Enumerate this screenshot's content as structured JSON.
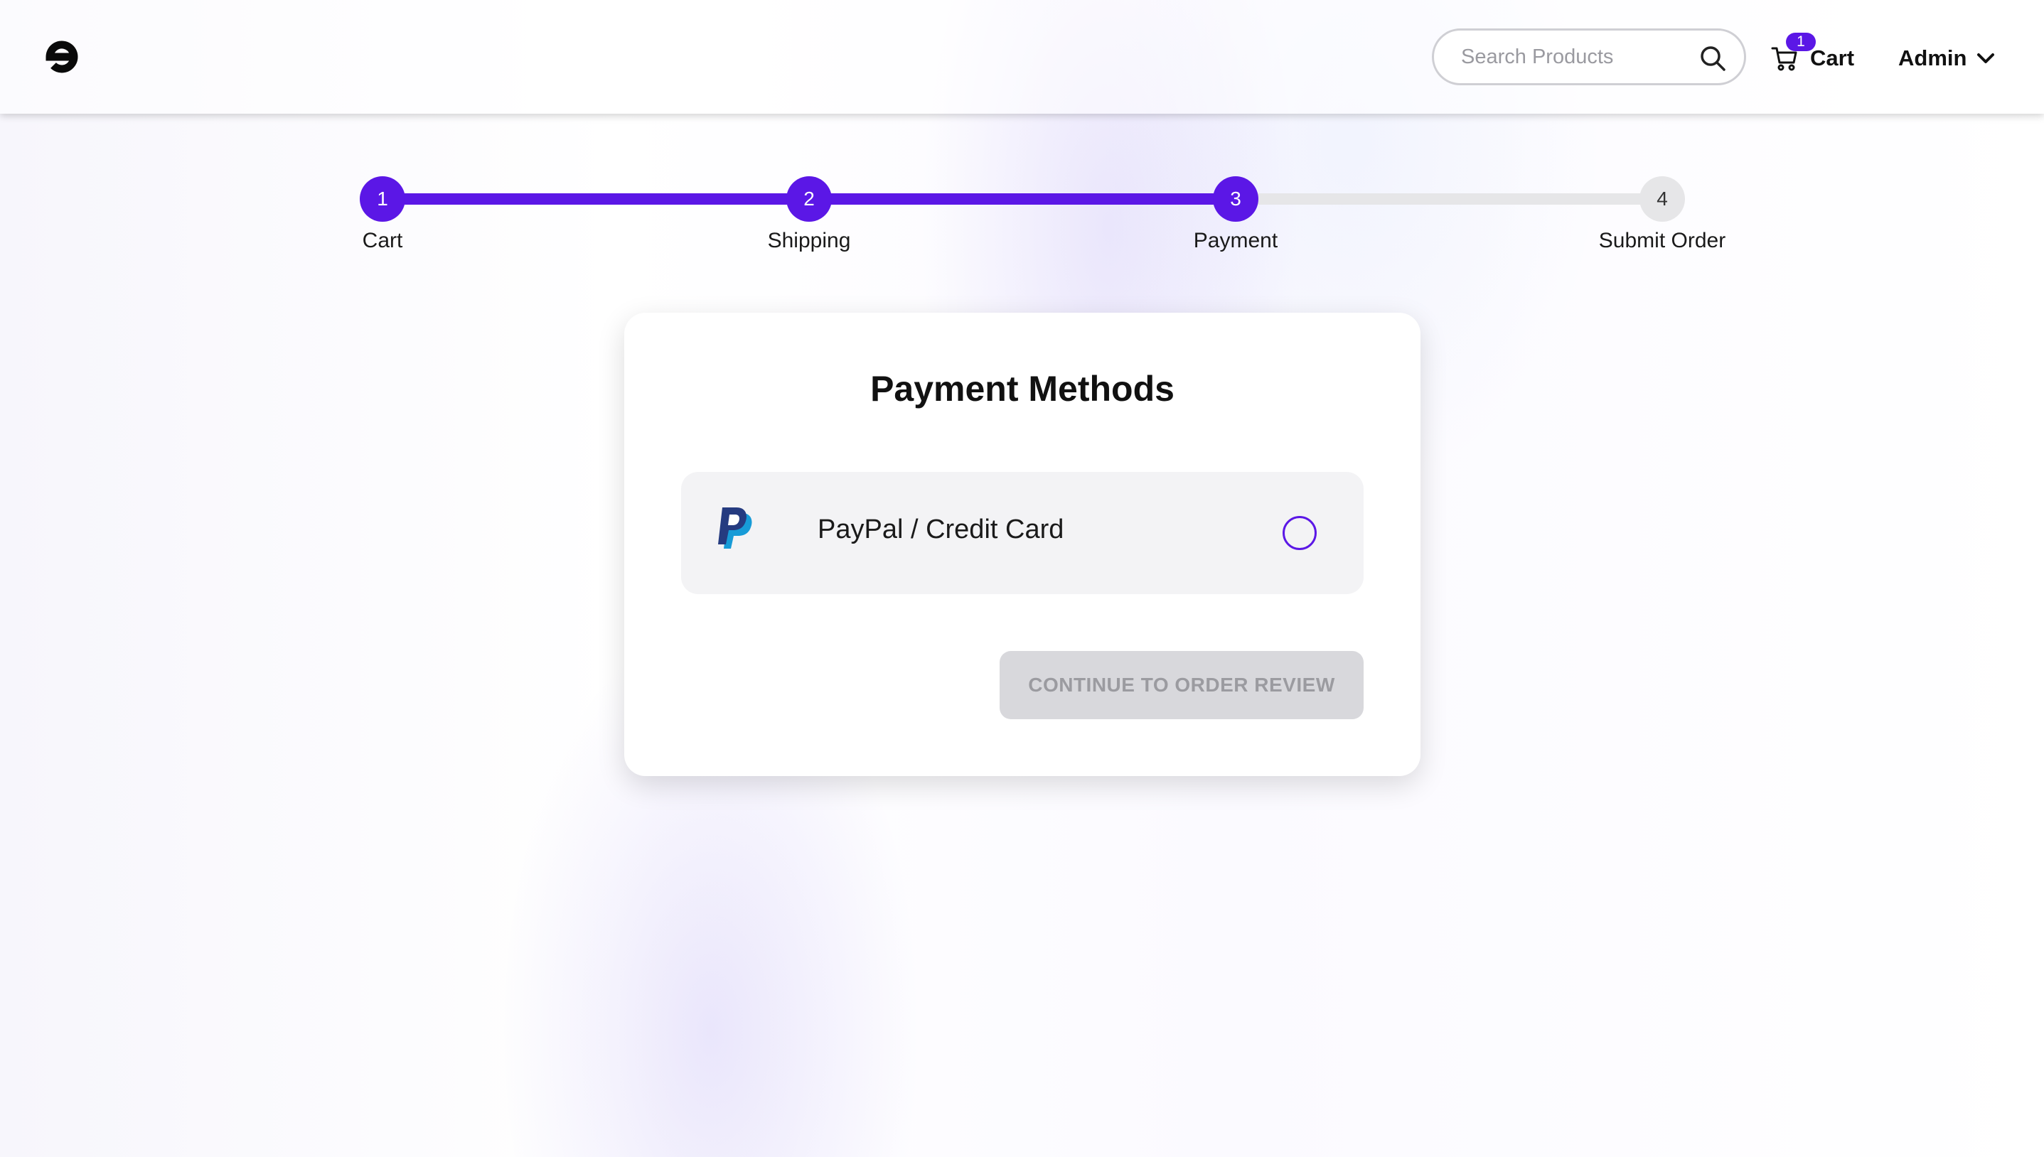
{
  "header": {
    "search": {
      "placeholder": "Search Products",
      "value": ""
    },
    "cart": {
      "badge_count": "1",
      "label": "Cart"
    },
    "user": {
      "label": "Admin"
    }
  },
  "stepper": {
    "current_step": 3,
    "steps": [
      {
        "number": "1",
        "label": "Cart",
        "completed": true
      },
      {
        "number": "2",
        "label": "Shipping",
        "completed": true
      },
      {
        "number": "3",
        "label": "Payment",
        "completed": true
      },
      {
        "number": "4",
        "label": "Submit Order",
        "completed": false
      }
    ]
  },
  "payment": {
    "title": "Payment Methods",
    "methods": [
      {
        "label": "PayPal / Credit Card",
        "icon": "paypal-icon",
        "selected": false
      }
    ],
    "continue_label": "CONTINUE TO ORDER REVIEW",
    "continue_disabled": true
  },
  "colors": {
    "accent": "#5b17e6",
    "inactive": "#e6e6e8",
    "disabled_button": "#d8d8dc",
    "paypal_dark": "#253b80",
    "paypal_light": "#179bd7"
  }
}
